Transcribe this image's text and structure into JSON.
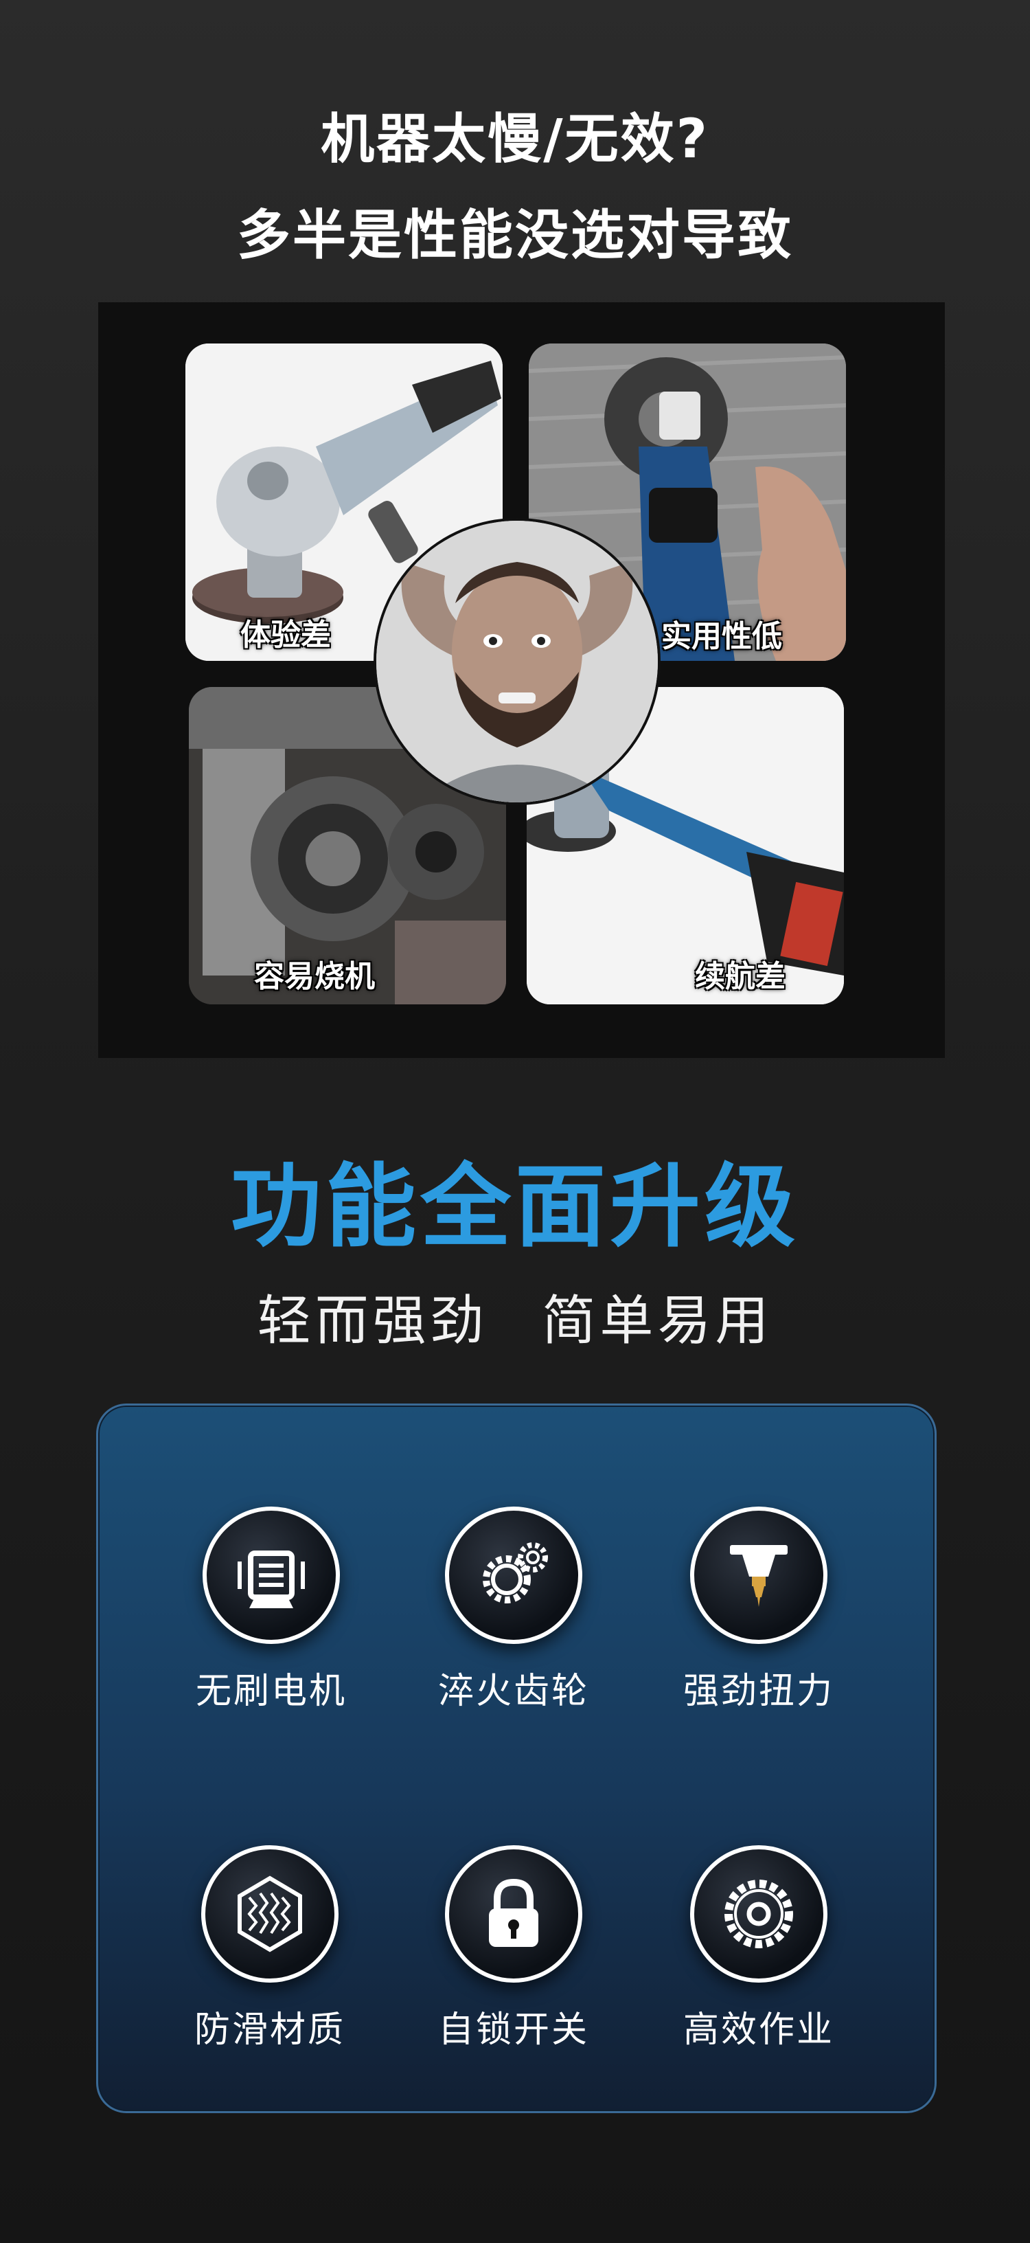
{
  "headline": {
    "line1": "机器太慢/无效?",
    "line2": "多半是性能没选对导致"
  },
  "problems": {
    "tiles": [
      {
        "label": "体验差",
        "icon": "air-angle-grinder"
      },
      {
        "label": "实用性低",
        "icon": "cordless-grinder-cutting-tile"
      },
      {
        "label": "容易烧机",
        "icon": "burnt-engine"
      },
      {
        "label": "续航差",
        "icon": "battery-grinder"
      }
    ],
    "center_image": "stressed-man"
  },
  "upgrade": {
    "title": "功能全面升级",
    "subtitle_left": "轻而强劲",
    "subtitle_right": "简单易用"
  },
  "features": [
    {
      "label": "无刷电机",
      "icon": "brushless-motor-icon"
    },
    {
      "label": "淬火齿轮",
      "icon": "gears-icon"
    },
    {
      "label": "强劲扭力",
      "icon": "drill-torque-icon"
    },
    {
      "label": "防滑材质",
      "icon": "anti-slip-texture-icon"
    },
    {
      "label": "自锁开关",
      "icon": "padlock-icon"
    },
    {
      "label": "高效作业",
      "icon": "saw-blade-icon"
    }
  ],
  "colors": {
    "title_blue": "#2c9be0",
    "panel_blue": "#1c4f77",
    "drill_gold": "#d9a441"
  }
}
